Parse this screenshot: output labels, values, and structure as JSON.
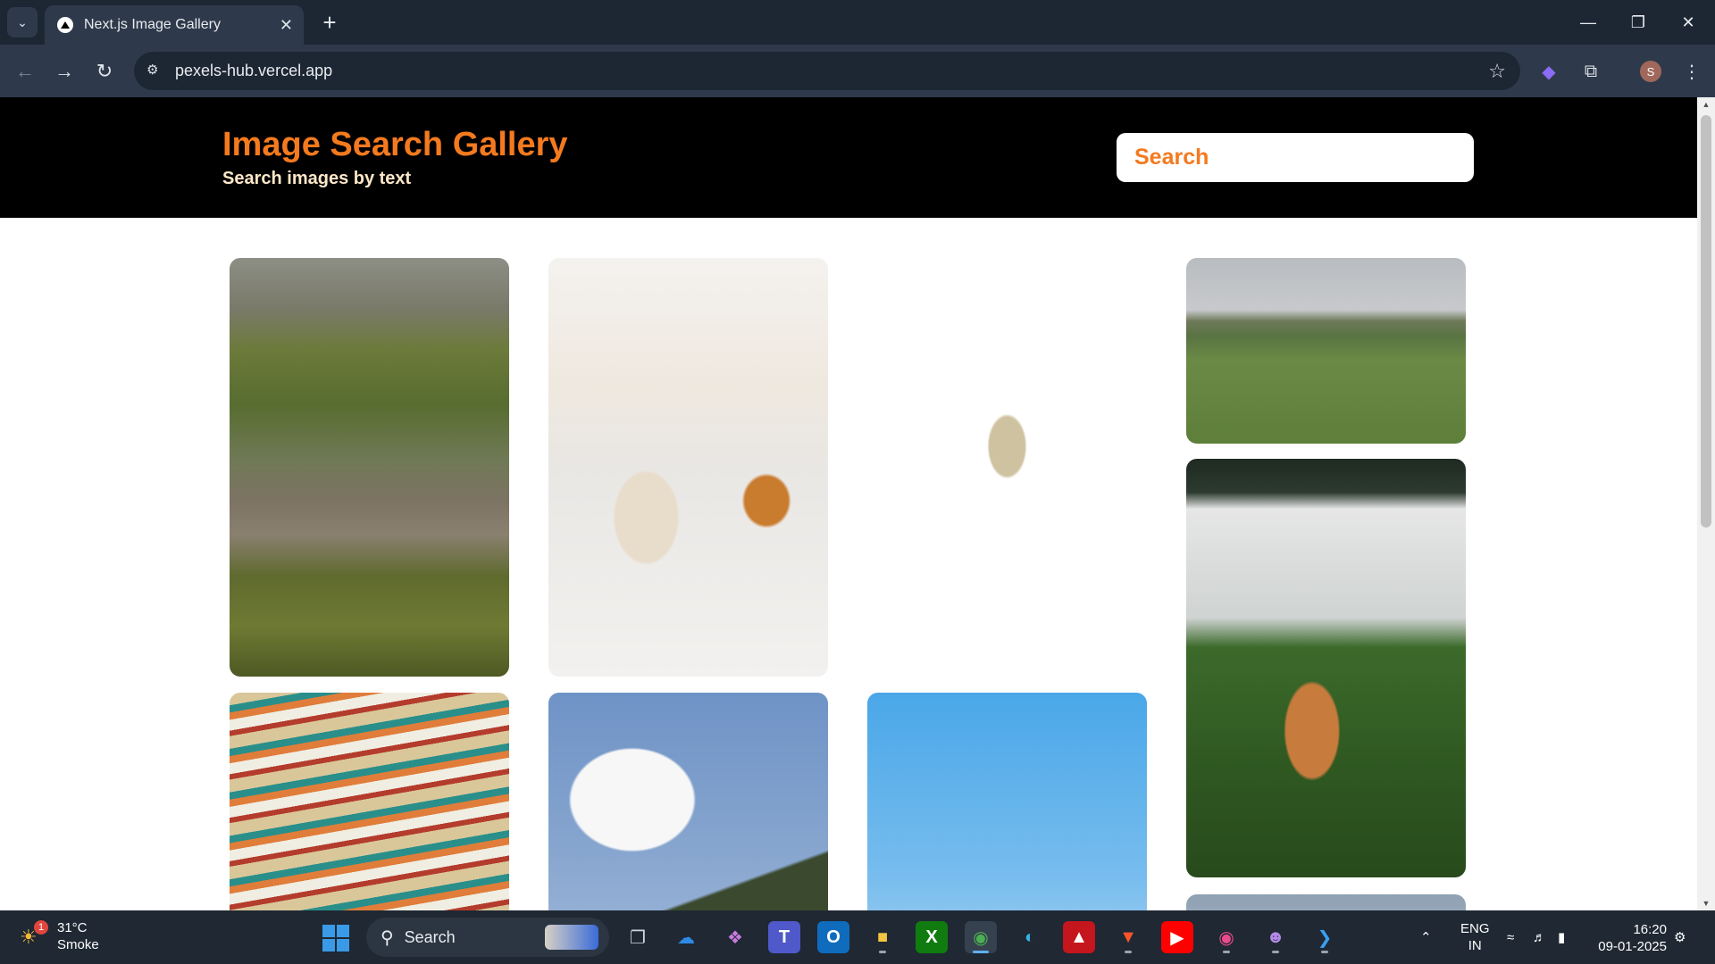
{
  "browser": {
    "tab_title": "Next.js Image Gallery",
    "url": "pexels-hub.vercel.app"
  },
  "header": {
    "title": "Image Search Gallery",
    "subtitle": "Search images by text",
    "search_placeholder": "Search"
  },
  "gallery": {
    "images": [
      {
        "subject": "green hills with people on path",
        "column": 1
      },
      {
        "subject": "coffee cup and croissant",
        "column": 2
      },
      {
        "subject": "dried leaf on white",
        "column": 3
      },
      {
        "subject": "sheep in field",
        "column": 4
      },
      {
        "subject": "shiba inu dog by fence",
        "column": 4
      },
      {
        "subject": "colorful boats",
        "column": 1
      },
      {
        "subject": "cloud over mountain",
        "column": 2
      },
      {
        "subject": "mount fuji",
        "column": 3
      }
    ]
  },
  "taskbar": {
    "weather_temp": "31°C",
    "weather_desc": "Smoke",
    "weather_badge": "1",
    "search_label": "Search",
    "language_line1": "ENG",
    "language_line2": "IN",
    "time": "16:20",
    "date": "09-01-2025"
  },
  "profile_initial": "S"
}
